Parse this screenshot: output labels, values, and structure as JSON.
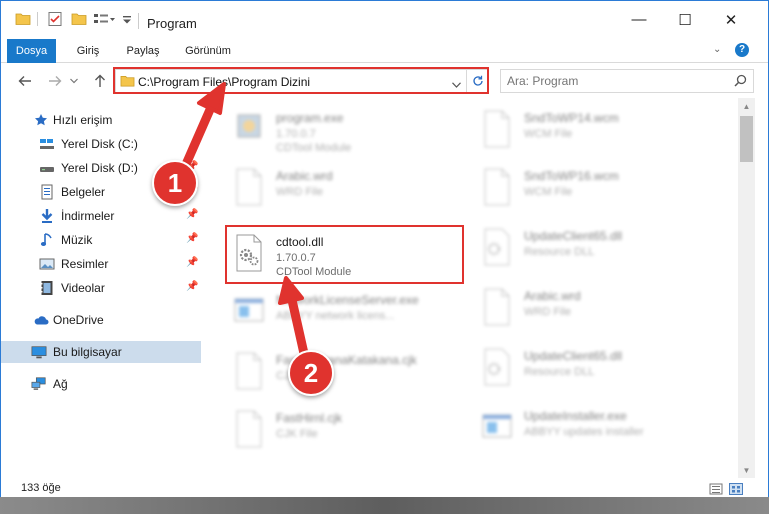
{
  "window": {
    "title": "Program",
    "minimize": "—",
    "maximize": "☐",
    "close": "✕"
  },
  "ribbon": {
    "tabs": [
      {
        "label": "Dosya",
        "active": true
      },
      {
        "label": "Giriş",
        "active": false
      },
      {
        "label": "Paylaş",
        "active": false
      },
      {
        "label": "Görünüm",
        "active": false
      }
    ]
  },
  "address": {
    "path": "C:\\Program Files\\Program Dizini",
    "search_placeholder": "Ara: Program"
  },
  "sidebar": {
    "items": [
      {
        "label": "Hızlı erişim",
        "icon": "star-icon",
        "pinned": false,
        "selected": false
      },
      {
        "label": "Yerel Disk (C:)",
        "icon": "drive-icon",
        "pinned": false,
        "selected": false
      },
      {
        "label": "Yerel Disk (D:)",
        "icon": "drive-icon",
        "pinned": true,
        "selected": false
      },
      {
        "label": "Belgeler",
        "icon": "documents-icon",
        "pinned": true,
        "selected": false
      },
      {
        "label": "İndirmeler",
        "icon": "download-icon",
        "pinned": true,
        "selected": false
      },
      {
        "label": "Müzik",
        "icon": "music-icon",
        "pinned": true,
        "selected": false
      },
      {
        "label": "Resimler",
        "icon": "pictures-icon",
        "pinned": true,
        "selected": false
      },
      {
        "label": "Videolar",
        "icon": "video-icon",
        "pinned": true,
        "selected": false
      },
      {
        "label": "OneDrive",
        "icon": "cloud-icon",
        "pinned": false,
        "selected": false
      },
      {
        "label": "Bu bilgisayar",
        "icon": "computer-icon",
        "pinned": false,
        "selected": true
      },
      {
        "label": "Ağ",
        "icon": "network-icon",
        "pinned": false,
        "selected": false
      }
    ]
  },
  "files": {
    "left": [
      {
        "name": "program.exe",
        "version": "1.70.0.7",
        "desc": "CDTool Module",
        "type": "exe"
      },
      {
        "name": "Arabic.wrd",
        "version": "WRD File",
        "desc": "",
        "type": "doc"
      },
      {
        "name": "cdtool.dll",
        "version": "1.70.0.7",
        "desc": "CDTool Module",
        "type": "dll"
      },
      {
        "name": "NetworkLicenseServer.exe",
        "version": "ABBYY network licens...",
        "desc": "",
        "type": "app"
      },
      {
        "name": "FastHiraganaKatakana.cjk",
        "version": "CJK File",
        "desc": "",
        "type": "doc"
      },
      {
        "name": "FastHirnl.cjk",
        "version": "CJK File",
        "desc": "",
        "type": "doc"
      }
    ],
    "right": [
      {
        "name": "SndToWP14.wcm",
        "version": "WCM File",
        "type": "doc"
      },
      {
        "name": "SndToWP16.wcm",
        "version": "WCM File",
        "type": "doc"
      },
      {
        "name": "UpdateClient65.dll",
        "version": "Resource DLL",
        "type": "dll"
      },
      {
        "name": "Arabic.wrd",
        "version": "WRD File",
        "type": "doc"
      },
      {
        "name": "UpdateClient65.dll",
        "version": "Resource DLL",
        "type": "dll"
      },
      {
        "name": "UpdateInstaller.exe",
        "version": "ABBYY updates installer",
        "type": "app"
      }
    ]
  },
  "status": {
    "count": "133 öğe"
  },
  "callouts": {
    "one": "1",
    "two": "2"
  },
  "colors": {
    "accent": "#1979ca",
    "highlight": "#e0332e"
  }
}
